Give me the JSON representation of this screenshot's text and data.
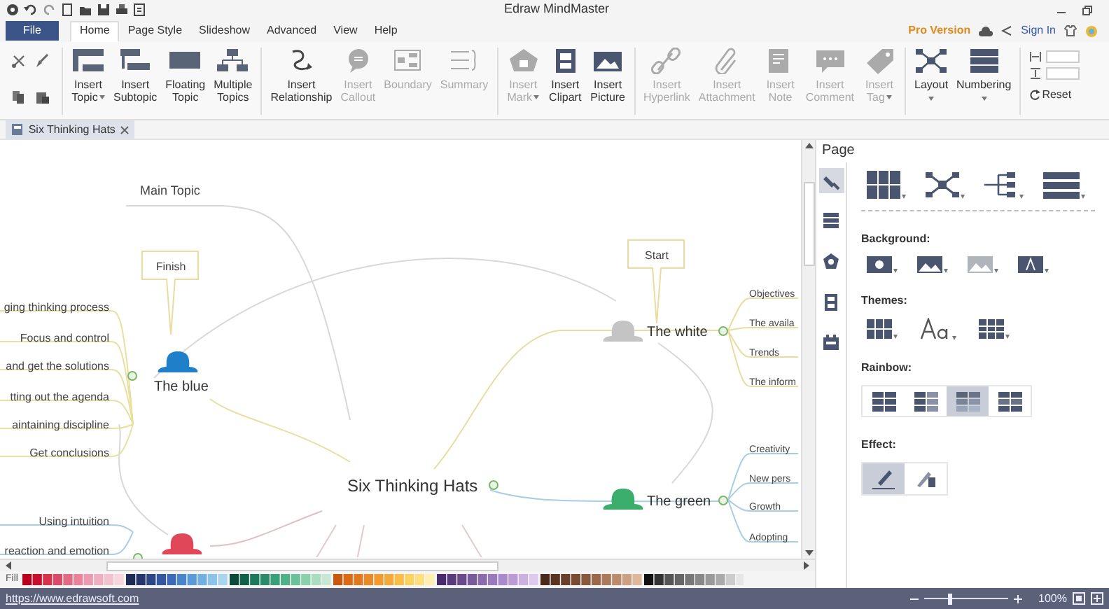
{
  "window": {
    "title": "Edraw MindMaster"
  },
  "menu": {
    "file": "File",
    "tabs": [
      {
        "label": "Home",
        "selected": true
      },
      {
        "label": "Page Style",
        "selected": false
      },
      {
        "label": "Slideshow",
        "selected": false
      },
      {
        "label": "Advanced",
        "selected": false
      },
      {
        "label": "View",
        "selected": false
      },
      {
        "label": "Help",
        "selected": false
      }
    ]
  },
  "account": {
    "pro": "Pro Version",
    "sign_in": "Sign In"
  },
  "ribbon": {
    "groups": [
      {
        "buttons": [
          {
            "lines": [
              "Insert",
              "Topic"
            ],
            "disabled": false,
            "dropdown": true
          },
          {
            "lines": [
              "Insert",
              "Subtopic"
            ],
            "disabled": false,
            "dropdown": false
          },
          {
            "lines": [
              "Floating",
              "Topic"
            ],
            "disabled": false,
            "dropdown": false
          },
          {
            "lines": [
              "Multiple",
              "Topics"
            ],
            "disabled": false,
            "dropdown": false
          }
        ]
      },
      {
        "buttons": [
          {
            "lines": [
              "Insert",
              "Relationship"
            ],
            "disabled": false,
            "dropdown": false
          },
          {
            "lines": [
              "Insert",
              "Callout"
            ],
            "disabled": true,
            "dropdown": false
          },
          {
            "lines": [
              "Boundary"
            ],
            "disabled": true,
            "dropdown": false
          },
          {
            "lines": [
              "Summary"
            ],
            "disabled": true,
            "dropdown": false
          }
        ]
      },
      {
        "buttons": [
          {
            "lines": [
              "Insert",
              "Mark"
            ],
            "disabled": true,
            "dropdown": true
          },
          {
            "lines": [
              "Insert",
              "Clipart"
            ],
            "disabled": false,
            "dropdown": false
          },
          {
            "lines": [
              "Insert",
              "Picture"
            ],
            "disabled": false,
            "dropdown": false
          }
        ]
      },
      {
        "buttons": [
          {
            "lines": [
              "Insert",
              "Hyperlink"
            ],
            "disabled": true,
            "dropdown": false
          },
          {
            "lines": [
              "Insert",
              "Attachment"
            ],
            "disabled": true,
            "dropdown": false
          },
          {
            "lines": [
              "Insert",
              "Note"
            ],
            "disabled": true,
            "dropdown": false
          },
          {
            "lines": [
              "Insert",
              "Comment"
            ],
            "disabled": true,
            "dropdown": false
          },
          {
            "lines": [
              "Insert",
              "Tag"
            ],
            "disabled": true,
            "dropdown": true
          }
        ]
      },
      {
        "buttons": [
          {
            "lines": [
              "Layout"
            ],
            "disabled": false,
            "dropdown": true
          },
          {
            "lines": [
              "Numbering"
            ],
            "disabled": false,
            "dropdown": true
          }
        ]
      }
    ],
    "reset": "Reset"
  },
  "document_tab": {
    "title": "Six Thinking Hats"
  },
  "mind_map": {
    "central": "Six Thinking Hats",
    "floating": "Main Topic",
    "branches": [
      {
        "label": "The blue",
        "color": "#1f7fc8",
        "callout": "Finish",
        "children": [
          "ging thinking process",
          "Focus and control",
          "and get the solutions",
          "tting out the agenda",
          "aintaining discipline",
          "Get conclusions"
        ]
      },
      {
        "label": "The white",
        "color": "#c4c4c4",
        "callout": "Start",
        "children": [
          "Objectives",
          "The availa",
          "Trends",
          "The inform"
        ]
      },
      {
        "label": "The green",
        "color": "#3aae6a",
        "children": [
          "Creativity",
          "New pers",
          "Growth",
          "Adopting"
        ]
      },
      {
        "color": "#e0485a",
        "children": [
          "Using intuition",
          "reaction and emotion"
        ]
      }
    ]
  },
  "fill_label": "Fill",
  "panel": {
    "title": "Page",
    "side_tabs": [
      {
        "selected": true
      },
      {
        "selected": false
      },
      {
        "selected": false
      },
      {
        "selected": false
      },
      {
        "selected": false
      }
    ],
    "background": "Background:",
    "themes": "Themes:",
    "rainbow": "Rainbow:",
    "effect": "Effect:",
    "rainbow_options": [
      {
        "selected": false
      },
      {
        "selected": false
      },
      {
        "selected": true
      },
      {
        "selected": false
      }
    ],
    "effect_options": [
      {
        "selected": true
      },
      {
        "selected": false
      }
    ]
  },
  "status": {
    "link": "https://www.edrawsoft.com",
    "zoom_slider": {
      "level": 0.3
    },
    "zoom": "100%"
  }
}
